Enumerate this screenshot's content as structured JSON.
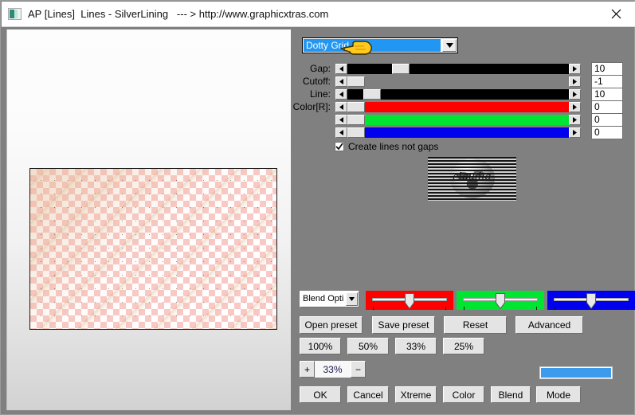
{
  "window": {
    "title": "AP [Lines]  Lines - SilverLining   --- > http://www.graphicxtras.com",
    "icon": "image-icon",
    "close_label": "close-icon"
  },
  "preview": {
    "canvas_name": "transparency-checkerboard-canvas"
  },
  "effect_combo": {
    "value": "Dotty Grid",
    "arrow": "▼",
    "cursor": "pointing-hand-cursor"
  },
  "sliders": [
    {
      "label": "Gap:",
      "value": "10",
      "thumb_pct": 22,
      "bar_color": "#000000",
      "fill_pct": 0,
      "name": "gap"
    },
    {
      "label": "Cutoff:",
      "value": "-1",
      "thumb_pct": 0,
      "bar_color": "#808080",
      "fill_pct": 0,
      "name": "cutoff"
    },
    {
      "label": "Line:",
      "value": "10",
      "thumb_pct": 8,
      "bar_color": "#000000",
      "fill_pct": 0,
      "name": "line"
    },
    {
      "label": "Color[R]:",
      "value": "0",
      "thumb_pct": 0,
      "bar_color": "#ff0000",
      "fill_pct": 0,
      "name": "color-red"
    },
    {
      "label": "",
      "value": "0",
      "thumb_pct": 0,
      "bar_color": "#00e432",
      "fill_pct": 0,
      "name": "color-green"
    },
    {
      "label": "",
      "value": "0",
      "thumb_pct": 0,
      "bar_color": "#0000ee",
      "fill_pct": 0,
      "name": "color-blue"
    }
  ],
  "checkbox": {
    "label": "Create lines not gaps",
    "checked": true
  },
  "thumbnail": {
    "caption": "claudia"
  },
  "blend_combo": {
    "value": "Blend Opti",
    "arrow": "▼"
  },
  "trackbars": [
    {
      "name": "red-trackbar",
      "color": "#ff0000",
      "value_pct": 50
    },
    {
      "name": "green-trackbar",
      "color": "#00e432",
      "value_pct": 50
    },
    {
      "name": "blue-trackbar",
      "color": "#0000ee",
      "value_pct": 50
    }
  ],
  "preset_buttons": [
    "Open preset",
    "Save preset",
    "Reset",
    "Advanced"
  ],
  "zoom_buttons": [
    "100%",
    "50%",
    "33%",
    "25%"
  ],
  "zoom_stepper": {
    "increase": "+",
    "value": "33%",
    "decrease": "−"
  },
  "progress": {
    "fill_pct": 100,
    "color": "#3d9bee"
  },
  "action_buttons": [
    "OK",
    "Cancel",
    "Xtreme",
    "Color",
    "Blend",
    "Mode"
  ]
}
